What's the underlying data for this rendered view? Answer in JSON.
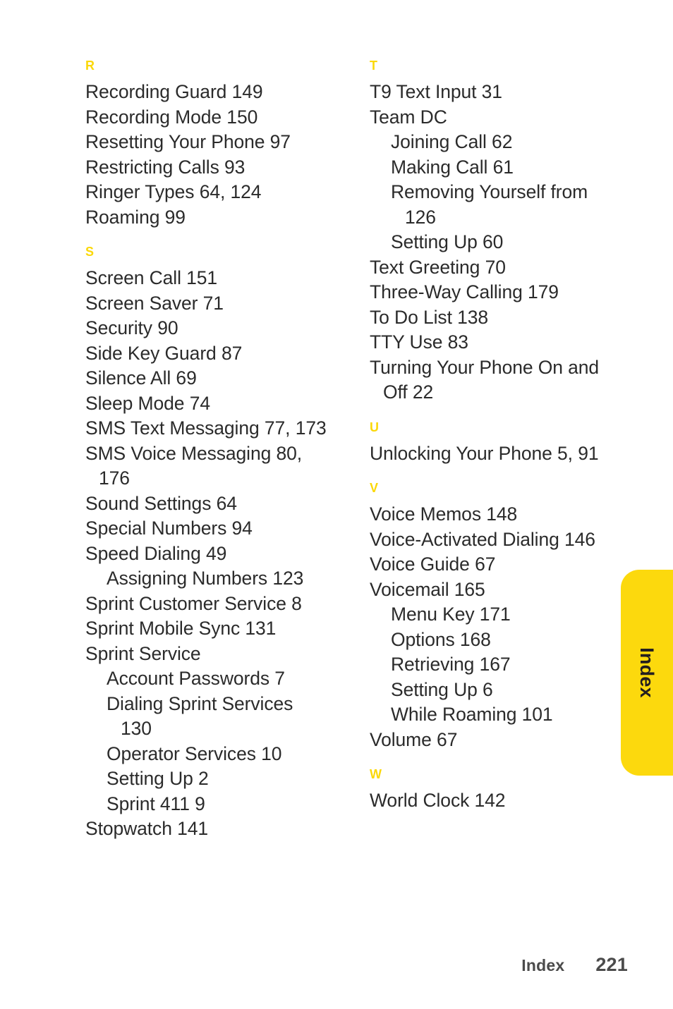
{
  "document": {
    "type": "index-page",
    "page_number": "221",
    "footer_label": "Index",
    "side_tab_label": "Index",
    "accent_color": "#fbd808",
    "tab_color": "#fcd90d",
    "text_color": "#2b2b2b"
  },
  "columns": {
    "left": [
      {
        "letter": "R",
        "entries": [
          {
            "level": 0,
            "text": "Recording Guard 149"
          },
          {
            "level": 0,
            "text": "Recording Mode 150"
          },
          {
            "level": 0,
            "text": "Resetting Your Phone 97"
          },
          {
            "level": 0,
            "text": "Restricting Calls 93"
          },
          {
            "level": 0,
            "text": "Ringer Types 64, 124"
          },
          {
            "level": 0,
            "text": "Roaming 99"
          }
        ]
      },
      {
        "letter": "S",
        "entries": [
          {
            "level": 0,
            "text": "Screen Call 151"
          },
          {
            "level": 0,
            "text": "Screen Saver 71"
          },
          {
            "level": 0,
            "text": "Security 90"
          },
          {
            "level": 0,
            "text": "Side Key Guard 87"
          },
          {
            "level": 0,
            "text": "Silence All 69"
          },
          {
            "level": 0,
            "text": "Sleep Mode 74"
          },
          {
            "level": 0,
            "text": "SMS Text Messaging 77, 173"
          },
          {
            "level": 0,
            "text": "SMS Voice Messaging 80, 176"
          },
          {
            "level": 0,
            "text": "Sound Settings 64"
          },
          {
            "level": 0,
            "text": "Special Numbers 94"
          },
          {
            "level": 0,
            "text": "Speed Dialing 49"
          },
          {
            "level": 1,
            "text": "Assigning Numbers 123"
          },
          {
            "level": 0,
            "text": "Sprint Customer Service 8"
          },
          {
            "level": 0,
            "text": "Sprint Mobile Sync 131"
          },
          {
            "level": 0,
            "text": "Sprint Service"
          },
          {
            "level": 1,
            "text": "Account Passwords 7"
          },
          {
            "level": 1,
            "text": "Dialing Sprint Services 130"
          },
          {
            "level": 1,
            "text": "Operator Services 10"
          },
          {
            "level": 1,
            "text": "Setting Up 2"
          },
          {
            "level": 1,
            "text": "Sprint 411  9"
          },
          {
            "level": 0,
            "text": "Stopwatch 141"
          }
        ]
      }
    ],
    "right": [
      {
        "letter": "T",
        "entries": [
          {
            "level": 0,
            "text": "T9 Text Input 31"
          },
          {
            "level": 0,
            "text": "Team DC"
          },
          {
            "level": 1,
            "text": "Joining Call 62"
          },
          {
            "level": 1,
            "text": "Making Call 61"
          },
          {
            "level": 1,
            "text": "Removing Yourself from 126"
          },
          {
            "level": 1,
            "text": "Setting Up 60"
          },
          {
            "level": 0,
            "text": "Text Greeting 70"
          },
          {
            "level": 0,
            "text": "Three-Way Calling 179"
          },
          {
            "level": 0,
            "text": "To Do List 138"
          },
          {
            "level": 0,
            "text": "TTY Use 83"
          },
          {
            "level": 0,
            "text": "Turning Your Phone On and Off 22"
          }
        ]
      },
      {
        "letter": "U",
        "entries": [
          {
            "level": 0,
            "text": "Unlocking Your Phone 5, 91"
          }
        ]
      },
      {
        "letter": "V",
        "entries": [
          {
            "level": 0,
            "text": "Voice Memos 148"
          },
          {
            "level": 0,
            "text": "Voice-Activated Dialing 146"
          },
          {
            "level": 0,
            "text": "Voice Guide 67"
          },
          {
            "level": 0,
            "text": "Voicemail 165"
          },
          {
            "level": 1,
            "text": "Menu Key 171"
          },
          {
            "level": 1,
            "text": "Options 168"
          },
          {
            "level": 1,
            "text": "Retrieving 167"
          },
          {
            "level": 1,
            "text": "Setting Up 6"
          },
          {
            "level": 1,
            "text": "While Roaming 101"
          },
          {
            "level": 0,
            "text": "Volume 67"
          }
        ]
      },
      {
        "letter": "W",
        "entries": [
          {
            "level": 0,
            "text": "World Clock 142"
          }
        ]
      }
    ]
  }
}
